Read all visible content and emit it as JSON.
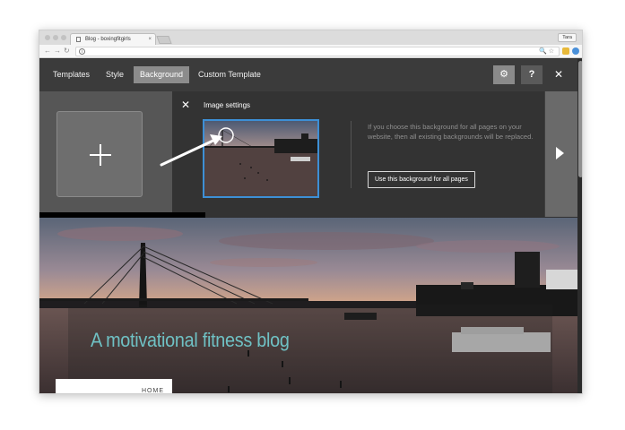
{
  "browser": {
    "tab_title": "Blog - boxingfitgirls",
    "tab_close": "×",
    "profile_name": "Tara",
    "back_glyph": "←",
    "forward_glyph": "→",
    "reload_glyph": "↻",
    "info_glyph": "i",
    "omnibox_icons": "🔍☆"
  },
  "editor_nav": {
    "items": [
      {
        "label": "Templates"
      },
      {
        "label": "Style"
      },
      {
        "label": "Background"
      },
      {
        "label": "Custom Template"
      }
    ],
    "active_index": 2,
    "gear_glyph": "⚙",
    "help_glyph": "?",
    "close_glyph": "✕"
  },
  "image_panel": {
    "close_glyph": "✕",
    "title": "Image settings",
    "info_text": "If you choose this background for all pages on your website, then all existing backgrounds will be replaced.",
    "use_all_label": "Use this background for all pages"
  },
  "site_preview": {
    "title": "A motivational fitness blog",
    "menu_item": "HOME"
  },
  "colors": {
    "accent": "#3d8fd6",
    "site_title": "#6fc1c4",
    "active_nav": "#8c8c8c"
  }
}
